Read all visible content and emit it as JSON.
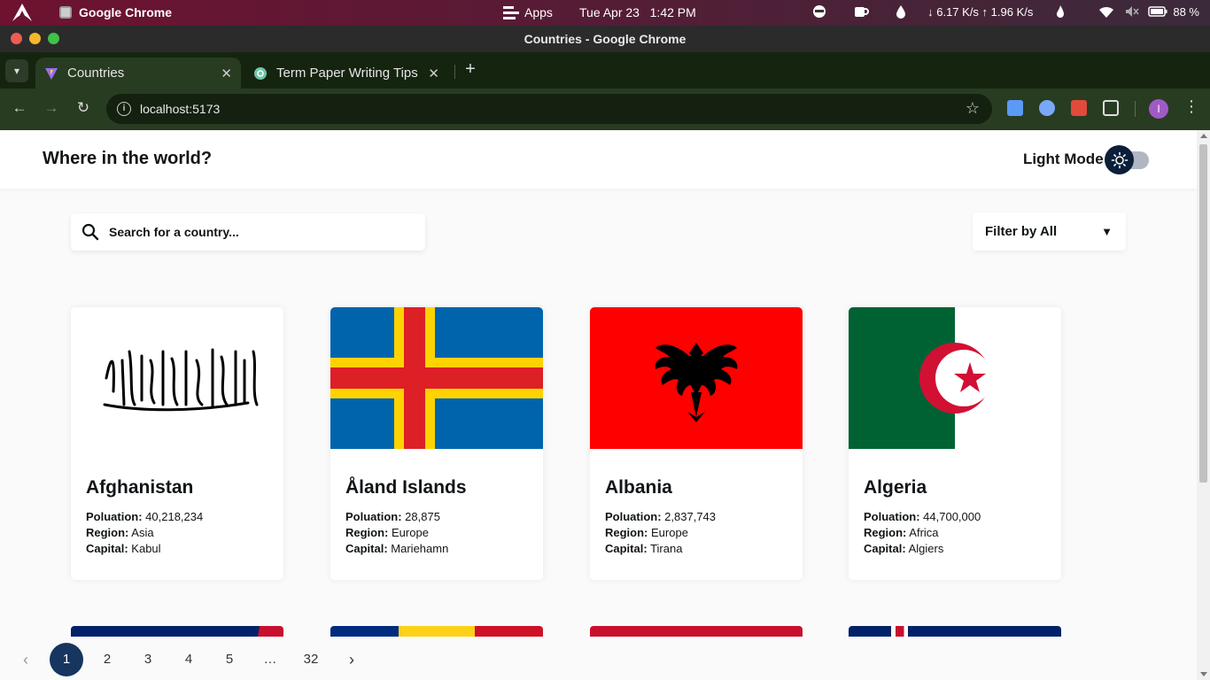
{
  "os": {
    "active_app": "Google Chrome",
    "apps_label": "Apps",
    "clock": "Tue Apr 23   1:42 PM",
    "network": "↓ 6.17 K/s ↑ 1.96 K/s",
    "battery": "88 %"
  },
  "window": {
    "title": "Countries - Google Chrome"
  },
  "tabs": [
    {
      "label": "Countries",
      "active": true
    },
    {
      "label": "Term Paper Writing Tips",
      "active": false
    }
  ],
  "toolbar": {
    "url": "localhost:5173",
    "profile_initial": "I"
  },
  "app": {
    "title": "Where in the world?",
    "mode_label": "Light Mode",
    "search_placeholder": "Search for a country...",
    "filter_label": "Filter by All"
  },
  "labels": {
    "population": "Poluation:",
    "region": "Region:",
    "capital": "Capital:"
  },
  "countries": [
    {
      "name": "Afghanistan",
      "population": "40,218,234",
      "region": "Asia",
      "capital": "Kabul"
    },
    {
      "name": "Åland Islands",
      "population": "28,875",
      "region": "Europe",
      "capital": "Mariehamn"
    },
    {
      "name": "Albania",
      "population": "2,837,743",
      "region": "Europe",
      "capital": "Tirana"
    },
    {
      "name": "Algeria",
      "population": "44,700,000",
      "region": "Africa",
      "capital": "Algiers"
    }
  ],
  "pagination": {
    "pages": [
      "1",
      "2",
      "3",
      "4",
      "5",
      "…",
      "32"
    ],
    "current": "1"
  },
  "colors": {
    "header_bg": "#ffffff",
    "page_bg": "#fafafa",
    "active_page": "#16355f",
    "text": "#111517"
  }
}
